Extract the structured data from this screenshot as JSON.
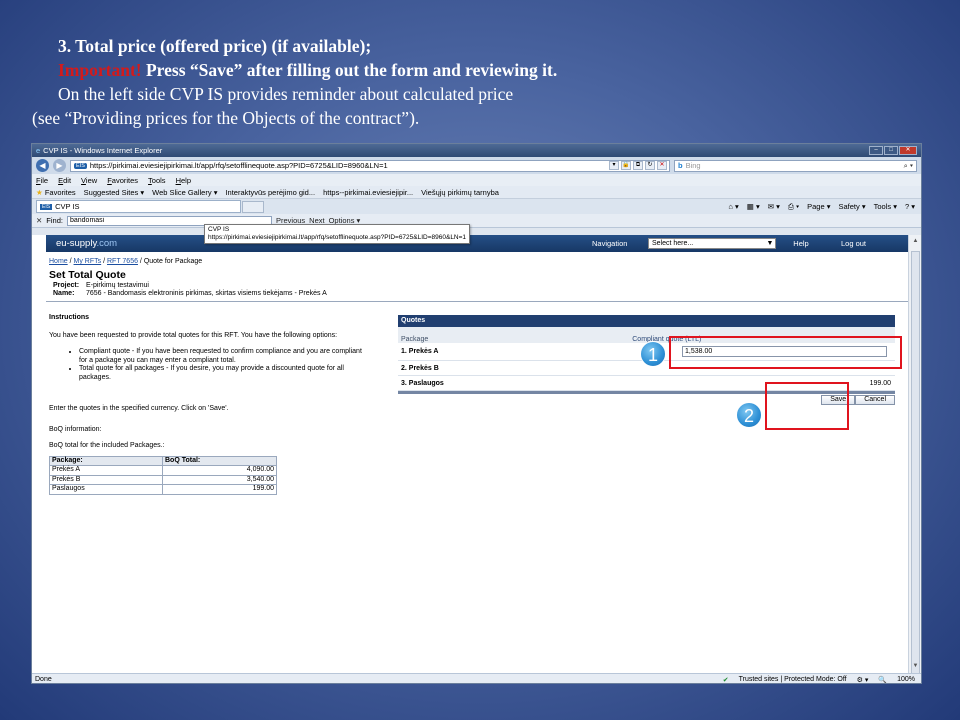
{
  "slide": {
    "line1": "3. Total price (offered price) (if available);",
    "important_label": "Important!",
    "line2_rest": " Press “Save” after filling out the form and reviewing it.",
    "line3": "On the left side CVP IS provides reminder about calculated price",
    "line4": "(see “Providing prices for the Objects of the contract”)."
  },
  "browser": {
    "window_title": "CVP IS - Windows Internet Explorer",
    "address_tag": "EIS",
    "url": "https://pirkimai.eviesiejipirkimai.lt/app/rfq/setofflinequote.asp?PID=6725&LID=8960&LN=1",
    "search_placeholder": "Bing",
    "menu": [
      "File",
      "Edit",
      "View",
      "Favorites",
      "Tools",
      "Help"
    ],
    "favorites_label": "Favorites",
    "favorites": [
      "Suggested Sites ▾",
      "Web Slice Gallery ▾",
      "Interaktyvūs perėjimo gid...",
      "https--pirkimai.eviesiejipir...",
      "Viešųjų pirkimų tarnyba"
    ],
    "tab_title": "CVP IS",
    "commands": [
      "Page ▾",
      "Safety ▾",
      "Tools ▾"
    ],
    "find_label": "Find:",
    "find_value": "bandomasi",
    "find_prev": "Previous",
    "find_next": "Next",
    "find_options": "Options ▾",
    "tooltip_title": "CVP IS",
    "tooltip_url": "https://pirkimai.eviesiejipirkimai.lt/app/rfq/setofflinequote.asp?PID=6725&LID=8960&LN=1"
  },
  "site": {
    "logo_left": "eu-supply",
    "logo_right": ".com",
    "navigation_label": "Navigation",
    "select_value": "Select here...",
    "help": "Help",
    "logout": "Log out",
    "breadcrumb": [
      "Home",
      "My RFTs",
      "RFT 7656",
      "Quote for Package"
    ],
    "page_title": "Set Total Quote",
    "project_label": "Project:",
    "project_value": "E-pirkimų testavimui",
    "name_label": "Name:",
    "name_value": "7656 - Bandomasis elektroninis pirkimas, skirtas visiems tiekėjams - Prekės A"
  },
  "instructions": {
    "heading": "Instructions",
    "intro": "You have been requested to provide total quotes for this RFT. You have the following options:",
    "options": [
      "Compliant quote - If you have been requested to confirm compliance and you are compliant for a package you can may enter a compliant total.",
      "Total quote for all packages - If you desire, you may provide a discounted quote for all packages."
    ],
    "currency_note": "Enter the quotes in the specified currency. Click on 'Save'.",
    "boq_info": "BoQ information:",
    "boq_total_note": "BoQ total for the included Packages.:",
    "boq_headers": [
      "Package:",
      "BoQ Total:"
    ],
    "boq_rows": [
      {
        "package": "Prekės A",
        "total": "4,090.00"
      },
      {
        "package": "Prekės B",
        "total": "3,540.00"
      },
      {
        "package": "Paslaugos",
        "total": "199.00"
      }
    ]
  },
  "quotes": {
    "title": "Quotes",
    "col_package": "Package",
    "col_quote": "Compliant quote (LTL)",
    "rows": [
      {
        "name": "1. Prekės A",
        "input": "1,538.00"
      },
      {
        "name": "2. Prekės B",
        "value": ""
      },
      {
        "name": "3. Paslaugos",
        "value": "199.00"
      }
    ],
    "save": "Save",
    "cancel": "Cancel"
  },
  "status": {
    "left": "Done",
    "zone": "Trusted sites | Protected Mode: Off",
    "zoom": "100%"
  },
  "callouts": [
    "1",
    "2"
  ],
  "colors": {
    "highlight": "#e0141e",
    "badge": "#2d8fd5",
    "important": "#d41a1a"
  }
}
